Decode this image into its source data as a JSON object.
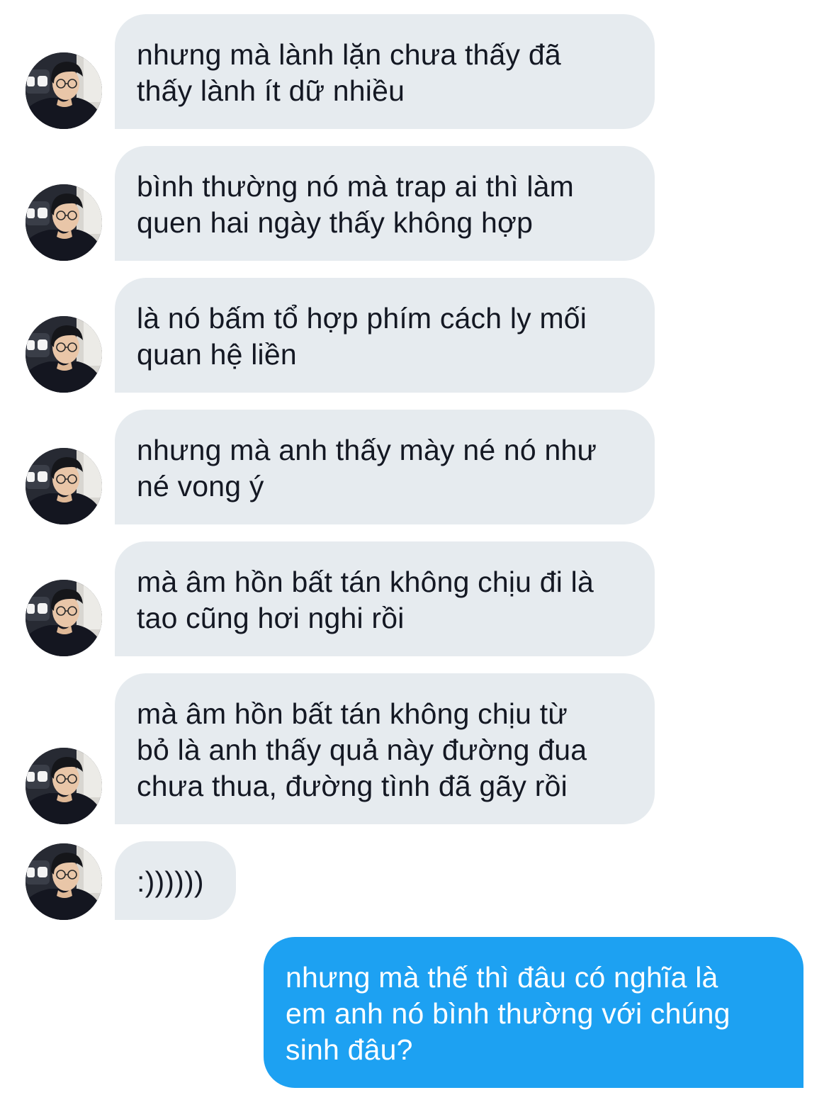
{
  "conversation": {
    "incoming": [
      {
        "text": "nhưng mà lành lặn chưa thấy đã\nthấy lành ít dữ nhiều"
      },
      {
        "text": "bình thường nó mà trap ai thì làm\nquen hai ngày thấy không hợp"
      },
      {
        "text": "là nó bấm tổ hợp phím cách ly mối\nquan hệ liền"
      },
      {
        "text": "nhưng mà anh thấy mày né nó như\nné vong ý"
      },
      {
        "text": "mà âm hồn bất tán không chịu đi là\ntao cũng hơi nghi rồi"
      },
      {
        "text": "mà âm hồn bất tán không chịu từ\nbỏ là anh thấy quả này đường đua\nchưa thua, đường tình đã gãy rồi"
      },
      {
        "text": ":))))))"
      }
    ],
    "outgoing": [
      {
        "text": "nhưng mà thế thì đâu có nghĩa là\nem anh nó bình thường với chúng\nsinh đâu?"
      }
    ]
  },
  "colors": {
    "incoming_bubble": "#e6ebef",
    "incoming_text": "#141823",
    "outgoing_bubble": "#1da1f2",
    "outgoing_text": "#ffffff"
  },
  "icons": {
    "avatar": "sender-profile-photo"
  }
}
